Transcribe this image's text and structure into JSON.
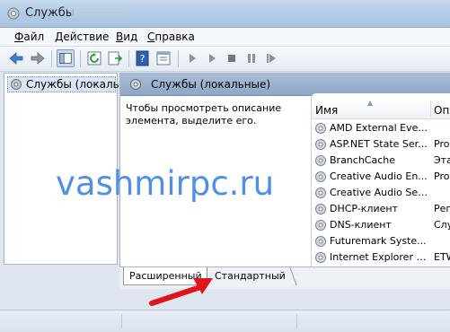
{
  "window": {
    "title": "Службы"
  },
  "menu": {
    "items": [
      "Файл",
      "Действие",
      "Вид",
      "Справка"
    ]
  },
  "tree": {
    "root_label": "Службы (локалы"
  },
  "pane": {
    "header": "Службы (локальные)",
    "description": "Чтобы просмотреть описание элемента, выделите его."
  },
  "list": {
    "columns": {
      "name": "Имя",
      "description": "Опи"
    },
    "rows": [
      {
        "name": "AMD External Eve...",
        "desc": ""
      },
      {
        "name": "ASP.NET State Ser...",
        "desc": "Prov"
      },
      {
        "name": "BranchCache",
        "desc": "Эта"
      },
      {
        "name": "Creative Audio En...",
        "desc": "Prov"
      },
      {
        "name": "Creative Audio Ser...",
        "desc": ""
      },
      {
        "name": "DHCP-клиент",
        "desc": "Рег"
      },
      {
        "name": "DNS-клиент",
        "desc": "Слу"
      },
      {
        "name": "Futuremark Syste...",
        "desc": ""
      },
      {
        "name": "Internet Explorer E...",
        "desc": "ETW"
      }
    ]
  },
  "tabs": {
    "extended": "Расширенный",
    "standard": "Стандартный"
  },
  "watermark": {
    "text": "vashmirpc.ru"
  },
  "colors": {
    "watermark": "#4f8fe6",
    "arrow": "#e0141c",
    "header": "#9db3cf"
  }
}
